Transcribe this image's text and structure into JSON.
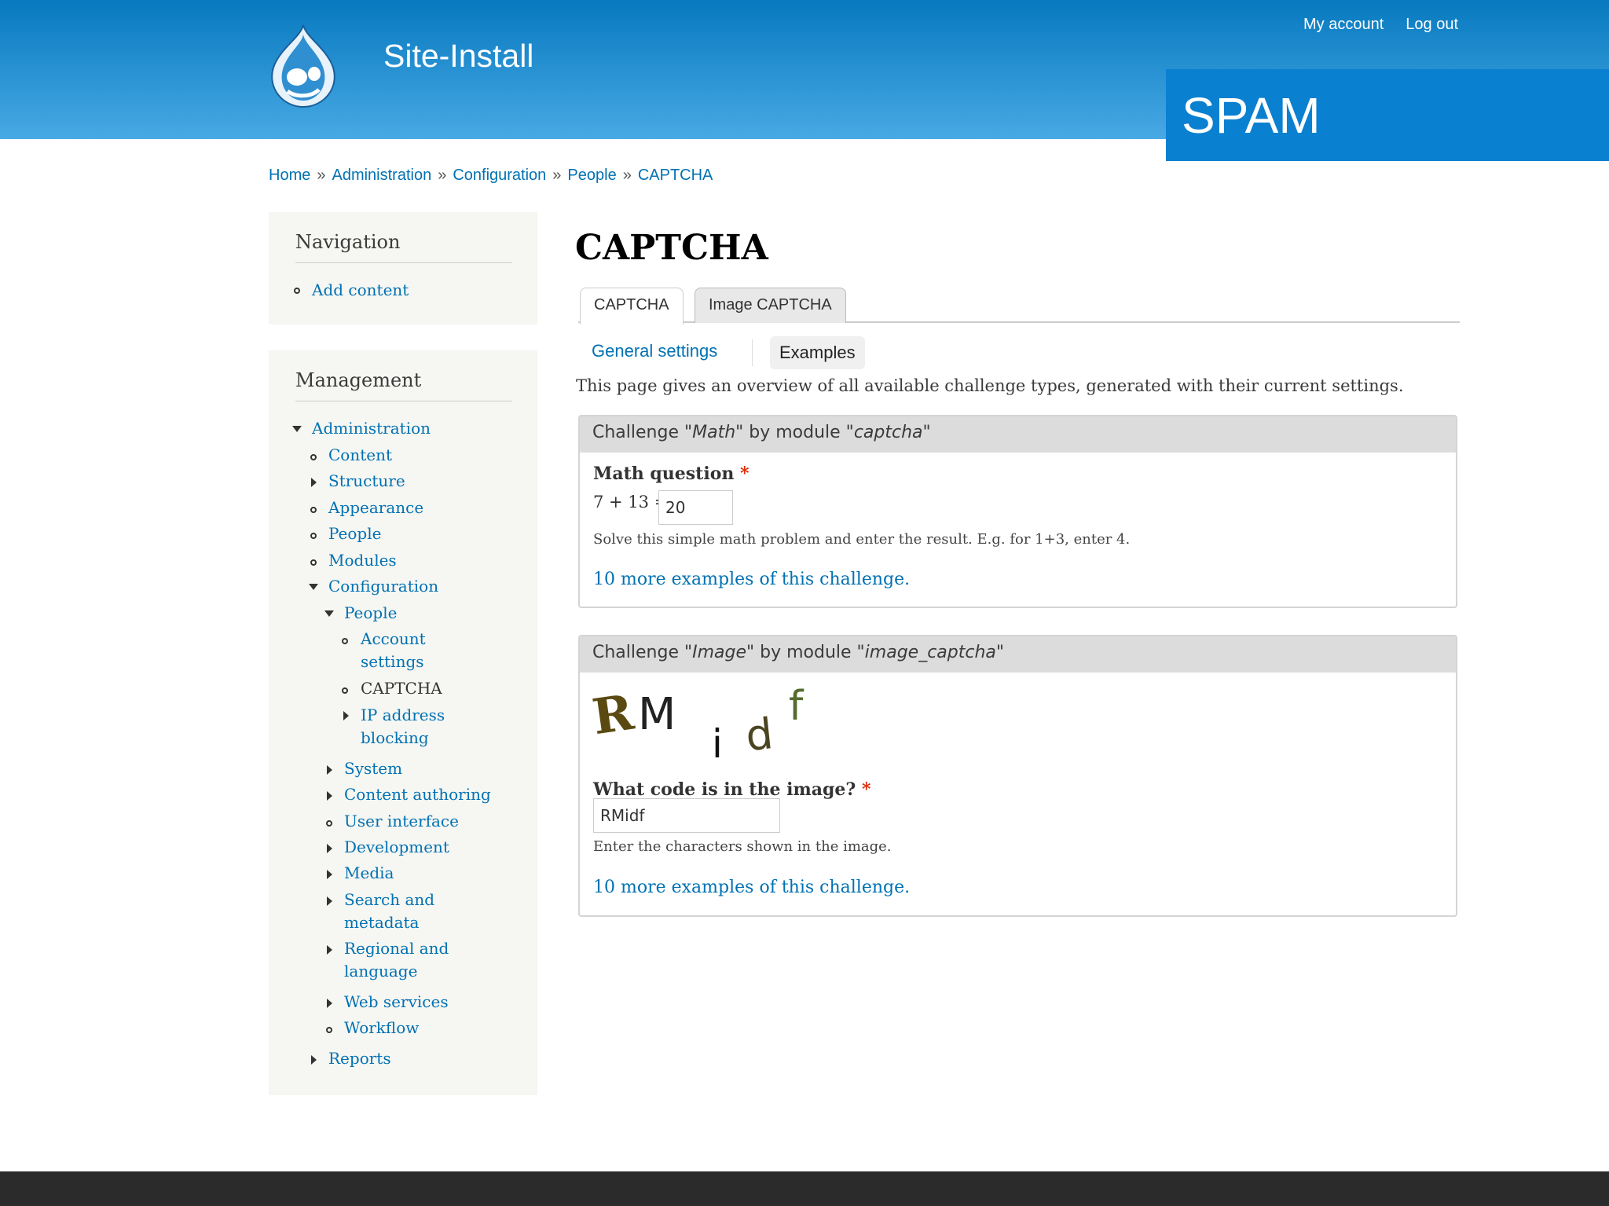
{
  "header": {
    "site_name": "Site-Install",
    "secondary_menu": [
      "My account",
      "Log out"
    ],
    "overlay_label": "SPAM",
    "colors": {
      "gradient_top": "#0779bf",
      "gradient_bottom": "#48a9e4",
      "overlay": "#0a80d1"
    }
  },
  "breadcrumb": [
    "Home",
    "Administration",
    "Configuration",
    "People",
    "CAPTCHA"
  ],
  "breadcrumb_separator": "»",
  "sidebar": {
    "navigation": {
      "title": "Navigation",
      "items": [
        {
          "label": "Add content"
        }
      ]
    },
    "management": {
      "title": "Management",
      "items": [
        {
          "label": "Administration"
        },
        {
          "label": "Content"
        },
        {
          "label": "Structure"
        },
        {
          "label": "Appearance"
        },
        {
          "label": "People"
        },
        {
          "label": "Modules"
        },
        {
          "label": "Configuration"
        },
        {
          "label": "People"
        },
        {
          "label": "Account"
        },
        {
          "label": "settings"
        },
        {
          "label": "CAPTCHA"
        },
        {
          "label": "IP address"
        },
        {
          "label": "blocking"
        },
        {
          "label": "System"
        },
        {
          "label": "Content authoring"
        },
        {
          "label": "User interface"
        },
        {
          "label": "Development"
        },
        {
          "label": "Media"
        },
        {
          "label": "Search and"
        },
        {
          "label": "metadata"
        },
        {
          "label": "Regional and"
        },
        {
          "label": "language"
        },
        {
          "label": "Web services"
        },
        {
          "label": "Workflow"
        },
        {
          "label": "Reports"
        }
      ]
    }
  },
  "main": {
    "title": "CAPTCHA",
    "primary_tabs": [
      "CAPTCHA",
      "Image CAPTCHA"
    ],
    "secondary_tabs": [
      "General settings",
      "Examples"
    ],
    "intro": "This page gives an overview of all available challenge types, generated with their current settings.",
    "challenges": [
      {
        "legend_prefix": "Challenge \"",
        "challenge": "Math",
        "legend_middle": "\" by module \"",
        "module": "captcha",
        "legend_suffix": "\"",
        "label": "Math question",
        "required_mark": "*",
        "question": "7 + 13 =",
        "value": "20",
        "description": "Solve this simple math problem and enter the result. E.g. for 1+3, enter 4.",
        "more_link": "10 more examples of this challenge."
      },
      {
        "legend_prefix": "Challenge \"",
        "challenge": "Image",
        "legend_middle": "\" by module \"",
        "module": "image_captcha",
        "legend_suffix": "\"",
        "captcha_chars": [
          "R",
          "M",
          "i",
          "d",
          "f"
        ],
        "label": "What code is in the image?",
        "required_mark": "*",
        "value": "RMidf",
        "description": "Enter the characters shown in the image.",
        "more_link": "10 more examples of this challenge."
      }
    ]
  }
}
